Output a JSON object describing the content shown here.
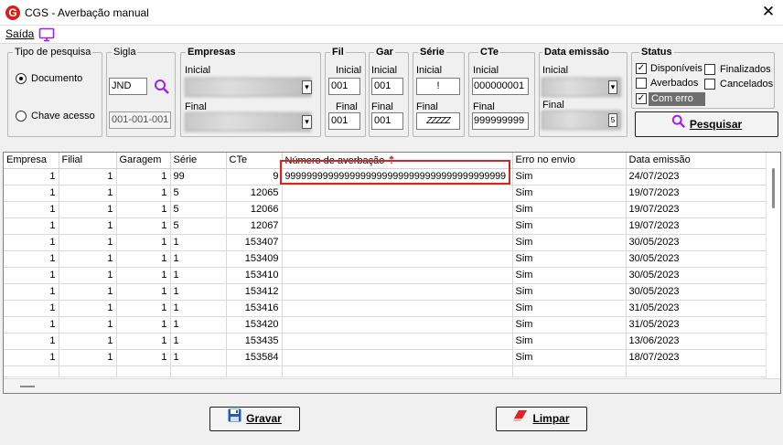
{
  "window": {
    "title": "CGS -  Averbação manual",
    "logo_letter": "G",
    "close_glyph": "✕"
  },
  "menu": {
    "saida": "Saída",
    "monitor_icon": "monitor-icon"
  },
  "tipo_pesquisa": {
    "legend": "Tipo de pesquisa",
    "documento": "Documento",
    "chave_acesso": "Chave acesso",
    "selected": "Documento"
  },
  "sigla": {
    "legend": "Sigla",
    "value": "JND",
    "chave_value": "001-001-001",
    "search_icon": "search-icon"
  },
  "empresas": {
    "legend": "Empresas",
    "inicial": "Inicial",
    "final": "Final"
  },
  "fil": {
    "legend": "Fil",
    "inicial": "Inicial",
    "final": "Final",
    "inicial_value": "001",
    "final_value": "001"
  },
  "gar": {
    "legend": "Gar",
    "inicial": "Inicial",
    "final": "Final",
    "inicial_value": "001",
    "final_value": "001"
  },
  "serie": {
    "legend": "Série",
    "inicial": "Inicial",
    "final": "Final",
    "inicial_value": "!",
    "final_value": "ZZZZZ"
  },
  "cte": {
    "legend": "CTe",
    "inicial": "Inicial",
    "final": "Final",
    "inicial_value": "000000001",
    "final_value": "999999999"
  },
  "data_emissao": {
    "legend": "Data emissão",
    "inicial": "Inicial",
    "final": "Final"
  },
  "status": {
    "legend": "Status",
    "disponiveis": "Disponíveis",
    "finalizados": "Finalizados",
    "averbados": "Averbados",
    "cancelados": "Cancelados",
    "com_erro": "Com erro",
    "disponiveis_checked": "true",
    "finalizados_checked": "false",
    "averbados_checked": "false",
    "cancelados_checked": "false",
    "com_erro_checked": "true"
  },
  "pesquisar": {
    "label": "Pesquisar",
    "icon": "search-icon"
  },
  "grid": {
    "columns": [
      "Empresa",
      "Filial",
      "Garagem",
      "Série",
      "CTe",
      "Número de averbação",
      "Erro no envio",
      "Data emissão"
    ],
    "sort_indicator": "⇡",
    "rows": [
      [
        "1",
        "1",
        "1",
        "99",
        "9",
        "99999999999999999999999999999999999999999",
        "Sim",
        "24/07/2023"
      ],
      [
        "1",
        "1",
        "1",
        "5",
        "12065",
        "",
        "Sim",
        "19/07/2023"
      ],
      [
        "1",
        "1",
        "1",
        "5",
        "12066",
        "",
        "Sim",
        "19/07/2023"
      ],
      [
        "1",
        "1",
        "1",
        "5",
        "12067",
        "",
        "Sim",
        "19/07/2023"
      ],
      [
        "1",
        "1",
        "1",
        "1",
        "153407",
        "",
        "Sim",
        "30/05/2023"
      ],
      [
        "1",
        "1",
        "1",
        "1",
        "153409",
        "",
        "Sim",
        "30/05/2023"
      ],
      [
        "1",
        "1",
        "1",
        "1",
        "153410",
        "",
        "Sim",
        "30/05/2023"
      ],
      [
        "1",
        "1",
        "1",
        "1",
        "153412",
        "",
        "Sim",
        "30/05/2023"
      ],
      [
        "1",
        "1",
        "1",
        "1",
        "153416",
        "",
        "Sim",
        "31/05/2023"
      ],
      [
        "1",
        "1",
        "1",
        "1",
        "153420",
        "",
        "Sim",
        "31/05/2023"
      ],
      [
        "1",
        "1",
        "1",
        "1",
        "153435",
        "",
        "Sim",
        "13/06/2023"
      ],
      [
        "1",
        "1",
        "1",
        "1",
        "153584",
        "",
        "Sim",
        "18/07/2023"
      ]
    ]
  },
  "buttons": {
    "gravar": "Gravar",
    "limpar": "Limpar"
  },
  "colors": {
    "highlight_box": "#d52525",
    "logo": "#d81e1e",
    "accent": "#a020f0"
  }
}
